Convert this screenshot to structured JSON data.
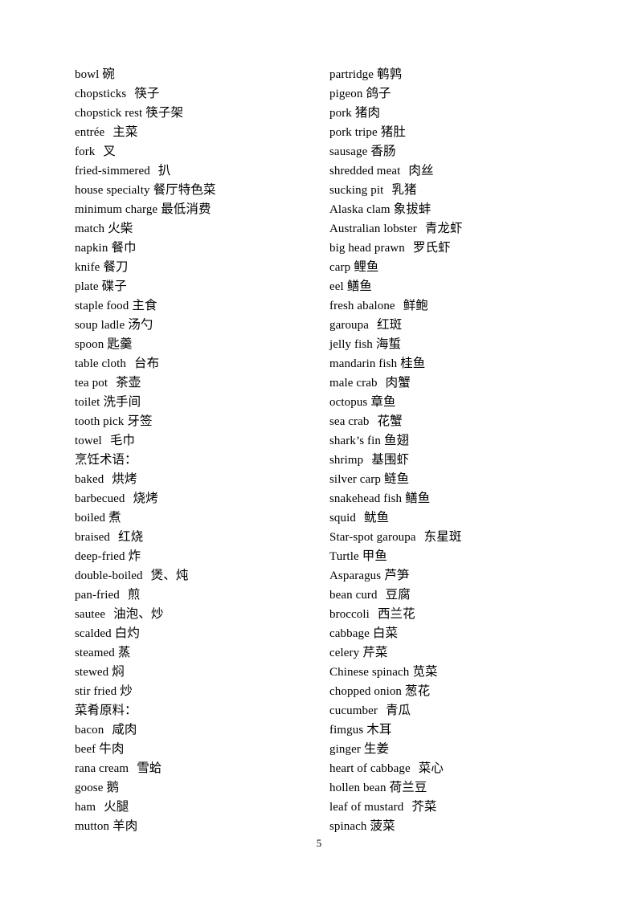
{
  "page": {
    "number": "5",
    "background_color": "#ffffff",
    "text_color": "#000000"
  },
  "columns": {
    "left": [
      {
        "type": "entry",
        "en": "bowl",
        "cn": "碗",
        "gap": 1
      },
      {
        "type": "entry",
        "en": "chopsticks",
        "cn": "筷子",
        "gap": 2
      },
      {
        "type": "entry",
        "en": "chopstick rest",
        "cn": "筷子架",
        "gap": 1
      },
      {
        "type": "entry",
        "en": "entrée",
        "cn": "主菜",
        "gap": 2
      },
      {
        "type": "entry",
        "en": "fork",
        "cn": "叉",
        "gap": 2
      },
      {
        "type": "entry",
        "en": "fried-simmered",
        "cn": "扒",
        "gap": 2
      },
      {
        "type": "entry",
        "en": "house specialty",
        "cn": "餐厅特色菜",
        "gap": 1
      },
      {
        "type": "entry",
        "en": "minimum  charge",
        "cn": "最低消费",
        "gap": 1
      },
      {
        "type": "entry",
        "en": "match",
        "cn": "火柴",
        "gap": 1
      },
      {
        "type": "entry",
        "en": "napkin",
        "cn": "餐巾",
        "gap": 1
      },
      {
        "type": "entry",
        "en": "knife",
        "cn": "餐刀",
        "gap": 1
      },
      {
        "type": "entry",
        "en": "plate",
        "cn": "碟子",
        "gap": 1
      },
      {
        "type": "entry",
        "en": "staple food",
        "cn": "主食",
        "gap": 1
      },
      {
        "type": "entry",
        "en": "soup ladle",
        "cn": "汤勺",
        "gap": 1
      },
      {
        "type": "entry",
        "en": "spoon",
        "cn": "匙羹",
        "gap": 1
      },
      {
        "type": "entry",
        "en": "table cloth",
        "cn": "台布",
        "gap": 2
      },
      {
        "type": "entry",
        "en": "tea pot",
        "cn": "茶壶",
        "gap": 2
      },
      {
        "type": "entry",
        "en": "toilet",
        "cn": "洗手间",
        "gap": 1
      },
      {
        "type": "entry",
        "en": "tooth pick",
        "cn": "牙签",
        "gap": 1
      },
      {
        "type": "entry",
        "en": "towel",
        "cn": "毛巾",
        "gap": 2
      },
      {
        "type": "heading",
        "cn": "烹饪术语："
      },
      {
        "type": "entry",
        "en": "baked",
        "cn": "烘烤",
        "gap": 2
      },
      {
        "type": "entry",
        "en": "barbecued",
        "cn": "烧烤",
        "gap": 2
      },
      {
        "type": "entry",
        "en": "boiled",
        "cn": "煮",
        "gap": 1
      },
      {
        "type": "entry",
        "en": "braised",
        "cn": "红烧",
        "gap": 2
      },
      {
        "type": "entry",
        "en": "deep-fried",
        "cn": "炸",
        "gap": 1
      },
      {
        "type": "entry",
        "en": "double-boiled",
        "cn": "煲、炖",
        "gap": 2
      },
      {
        "type": "entry",
        "en": "pan-fried",
        "cn": "煎",
        "gap": 2
      },
      {
        "type": "entry",
        "en": "sautee",
        "cn": "油泡、炒",
        "gap": 2
      },
      {
        "type": "entry",
        "en": "scalded",
        "cn": "白灼",
        "gap": 1
      },
      {
        "type": "entry",
        "en": "steamed",
        "cn": "蒸",
        "gap": 1
      },
      {
        "type": "entry",
        "en": "stewed",
        "cn": "焖",
        "gap": 1
      },
      {
        "type": "entry",
        "en": "stir fried",
        "cn": "炒",
        "gap": 1
      },
      {
        "type": "heading",
        "cn": "菜肴原料："
      },
      {
        "type": "entry",
        "en": "bacon",
        "cn": "咸肉",
        "gap": 2
      },
      {
        "type": "entry",
        "en": "beef",
        "cn": "牛肉",
        "gap": 1
      },
      {
        "type": "entry",
        "en": "rana cream",
        "cn": "雪蛤",
        "gap": 2
      },
      {
        "type": "entry",
        "en": "goose",
        "cn": "鹅",
        "gap": 1
      },
      {
        "type": "entry",
        "en": "ham",
        "cn": "火腿",
        "gap": 2
      },
      {
        "type": "entry",
        "en": "mutton",
        "cn": "羊肉",
        "gap": 1
      }
    ],
    "right": [
      {
        "type": "entry",
        "en": "partridge",
        "cn": "鹌鹑",
        "gap": 1
      },
      {
        "type": "entry",
        "en": "pigeon",
        "cn": "鸽子",
        "gap": 1
      },
      {
        "type": "entry",
        "en": "pork",
        "cn": "猪肉",
        "gap": 1
      },
      {
        "type": "entry",
        "en": "pork tripe",
        "cn": "猪肚",
        "gap": 1
      },
      {
        "type": "entry",
        "en": "sausage",
        "cn": "香肠",
        "gap": 1
      },
      {
        "type": "entry",
        "en": "shredded meat",
        "cn": "肉丝",
        "gap": 2
      },
      {
        "type": "entry",
        "en": "sucking pit",
        "cn": "乳猪",
        "gap": 2
      },
      {
        "type": "entry",
        "en": "Alaska clam",
        "cn": "象拔蚌",
        "gap": 1
      },
      {
        "type": "entry",
        "en": "Australian  lobster",
        "cn": "青龙虾",
        "gap": 2
      },
      {
        "type": "entry",
        "en": "big head prawn",
        "cn": "罗氏虾",
        "gap": 2
      },
      {
        "type": "entry",
        "en": "carp",
        "cn": "鲤鱼",
        "gap": 1
      },
      {
        "type": "entry",
        "en": "eel",
        "cn": "鳝鱼",
        "gap": 1
      },
      {
        "type": "entry",
        "en": "fresh abalone",
        "cn": "鲜鲍",
        "gap": 2
      },
      {
        "type": "entry",
        "en": "garoupa",
        "cn": "红斑",
        "gap": 2
      },
      {
        "type": "entry",
        "en": "jelly fish",
        "cn": "海蜇",
        "gap": 1
      },
      {
        "type": "entry",
        "en": "mandarin fish",
        "cn": "桂鱼",
        "gap": 1
      },
      {
        "type": "entry",
        "en": "male crab",
        "cn": "肉蟹",
        "gap": 2
      },
      {
        "type": "entry",
        "en": "octopus",
        "cn": "章鱼",
        "gap": 1
      },
      {
        "type": "entry",
        "en": "sea crab",
        "cn": "花蟹",
        "gap": 2
      },
      {
        "type": "entry",
        "en": "shark’s fin",
        "cn": "鱼翅",
        "gap": 1
      },
      {
        "type": "entry",
        "en": "shrimp",
        "cn": "基围虾",
        "gap": 2
      },
      {
        "type": "entry",
        "en": "silver carp",
        "cn": "鲢鱼",
        "gap": 1
      },
      {
        "type": "entry",
        "en": "snakehead fish",
        "cn": "鳝鱼",
        "gap": 1
      },
      {
        "type": "entry",
        "en": "squid",
        "cn": "鱿鱼",
        "gap": 2
      },
      {
        "type": "entry",
        "en": "Star-spot garoupa",
        "cn": "东星斑",
        "gap": 2
      },
      {
        "type": "entry",
        "en": "Turtle",
        "cn": "甲鱼",
        "gap": 1
      },
      {
        "type": "entry",
        "en": "Asparagus",
        "cn": "芦笋",
        "gap": 1
      },
      {
        "type": "entry",
        "en": "bean curd",
        "cn": "豆腐",
        "gap": 2
      },
      {
        "type": "entry",
        "en": "broccoli",
        "cn": "西兰花",
        "gap": 2
      },
      {
        "type": "entry",
        "en": "cabbage",
        "cn": "白菜",
        "gap": 1
      },
      {
        "type": "entry",
        "en": "celery",
        "cn": "芹菜",
        "gap": 1
      },
      {
        "type": "entry",
        "en": "Chinese spinach",
        "cn": "苋菜",
        "gap": 1
      },
      {
        "type": "entry",
        "en": "chopped onion",
        "cn": "葱花",
        "gap": 1
      },
      {
        "type": "entry",
        "en": "cucumber",
        "cn": "青瓜",
        "gap": 2
      },
      {
        "type": "entry",
        "en": "fimgus",
        "cn": "木耳",
        "gap": 1
      },
      {
        "type": "entry",
        "en": "ginger",
        "cn": "生姜",
        "gap": 1
      },
      {
        "type": "entry",
        "en": "heart of cabbage",
        "cn": "菜心",
        "gap": 2
      },
      {
        "type": "entry",
        "en": "hollen bean",
        "cn": "荷兰豆",
        "gap": 1
      },
      {
        "type": "entry",
        "en": "leaf of mustard",
        "cn": "芥菜",
        "gap": 2
      },
      {
        "type": "entry",
        "en": "spinach",
        "cn": "菠菜",
        "gap": 1
      }
    ]
  }
}
